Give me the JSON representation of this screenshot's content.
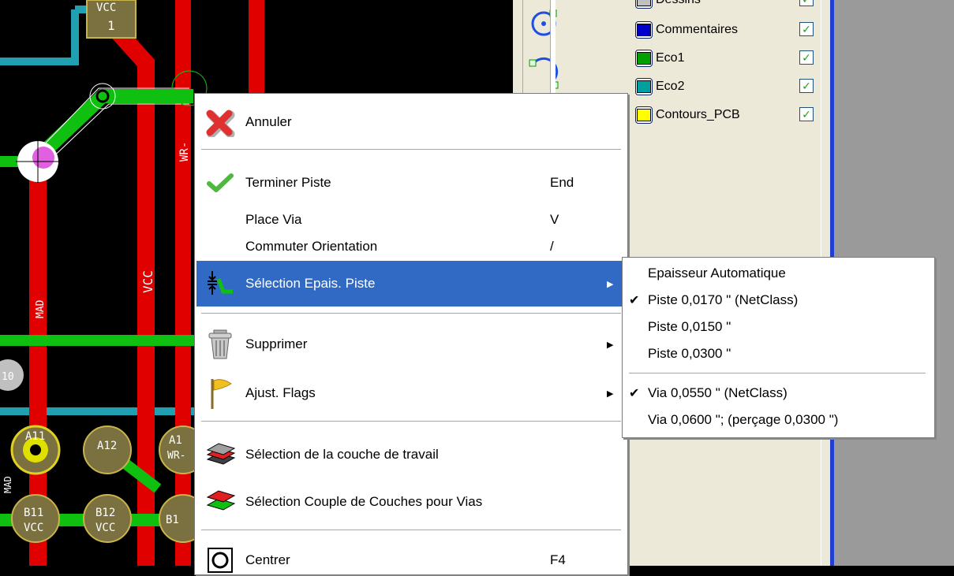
{
  "pcb": {
    "labels": {
      "vcc_top": "VCC",
      "pad_one": "1",
      "wr": "WR-",
      "vcc_vertical": "VCC",
      "mad": "MAD",
      "pad_left": "10",
      "mad_bottom": "MAD",
      "a11": "A11",
      "a12": "A12",
      "a13": "A1",
      "b11": "B11",
      "b12": "B12",
      "b13": "B1",
      "vcc_b11": "VCC",
      "vcc_b12": "VCC",
      "wr_a13": "WR-"
    }
  },
  "layers": {
    "partial_top": "Dessins",
    "items": [
      {
        "label": "Commentaires",
        "color": "#0000c8"
      },
      {
        "label": "Eco1",
        "color": "#00a000"
      },
      {
        "label": "Eco2",
        "color": "#00a0a0"
      },
      {
        "label": "Contours_PCB",
        "color": "#ffff00"
      }
    ]
  },
  "context_menu": {
    "annuler": "Annuler",
    "terminer_piste": "Terminer Piste",
    "terminer_piste_shortcut": "End",
    "place_via": "Place Via",
    "place_via_shortcut": "V",
    "commuter_orientation": "Commuter Orientation",
    "commuter_orientation_shortcut": "/",
    "selection_epais": "Sélection Epais. Piste",
    "supprimer": "Supprimer",
    "ajust_flags": "Ajust. Flags",
    "selection_couche": "Sélection de la couche de travail",
    "selection_couple": "Sélection Couple de Couches pour Vias",
    "centrer": "Centrer",
    "centrer_shortcut": "F4"
  },
  "submenu": {
    "epaisseur_auto": "Epaisseur Automatique",
    "piste_0170": "Piste 0,0170 \" (NetClass)",
    "piste_0150": "Piste 0,0150 \"",
    "piste_0300": "Piste 0,0300 \"",
    "via_0550": "Via 0,0550 \" (NetClass)",
    "via_0600": "Via 0,0600 \"; (perçage 0,0300 \")",
    "checkmark": "✔"
  },
  "colors": {
    "highlight": "#316ac5",
    "track_red": "#e00000",
    "track_green": "#10c010",
    "track_cyan": "#20a0b0",
    "pad_olive": "#7a7040"
  }
}
